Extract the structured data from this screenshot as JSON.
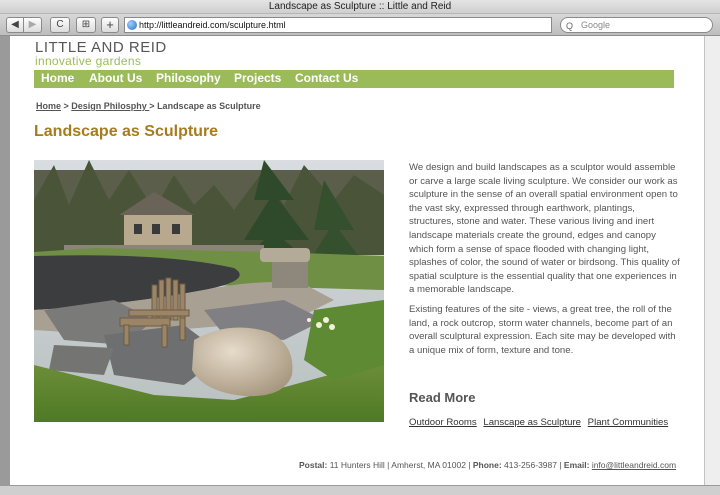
{
  "browser": {
    "window_title": "Landscape as Sculpture :: Little and Reid",
    "url": "http://littleandreid.com/sculpture.html",
    "search_placeholder": "Google",
    "back_glyph": "◀",
    "forward_glyph": "▶",
    "reload_glyph": "C",
    "snapback_glyph": "⊞",
    "add_bookmark_glyph": "+",
    "search_glyph": "Q"
  },
  "site": {
    "logo_line1": "LITTLE AND REID",
    "logo_line2": "innovative gardens",
    "accent_color": "#9bbb59",
    "title_color": "#a67c1c"
  },
  "nav": {
    "items": [
      {
        "label": "Home"
      },
      {
        "label": "About Us"
      },
      {
        "label": "Philosophy"
      },
      {
        "label": "Projects"
      },
      {
        "label": "Contact Us"
      }
    ]
  },
  "breadcrumb": {
    "home": "Home",
    "sep1": " > ",
    "section": "Design Philosphy ",
    "sep2": " > ",
    "current": "Landscape as Sculpture"
  },
  "page_title": "Landscape as Sculpture",
  "body": {
    "paragraph1": "We design and build landscapes as a sculptor would assemble or carve a large scale living sculpture. We consider our work as sculpture in the sense of an overall spatial environment open to the vast sky, expressed through earthwork, plantings, structures, stone and water. These various living and inert landscape materials create the ground, edges and canopy which form a sense of space flooded with changing light, splashes of color, the sound of water or birdsong. This quality of spatial sculpture is the essential quality that one experiences in a memorable landscape.",
    "paragraph2": "Existing features of the site - views, a great tree, the roll of the land, a rock outcrop, storm water channels, become part of an overall sculptural expression. Each site may be developed with a unique mix of form, texture and tone.",
    "read_more": "Read More",
    "links": [
      "Outdoor Rooms",
      "Lanscape as Sculpture",
      "Plant Communities"
    ]
  },
  "footer": {
    "postal_label": "Postal:",
    "postal": " 11 Hunters Hill | Amherst, MA 01002 | ",
    "phone_label": "Phone:",
    "phone": " 413-256-3987 | ",
    "email_label": "Email:",
    "email": "info@littleandreid.com"
  }
}
